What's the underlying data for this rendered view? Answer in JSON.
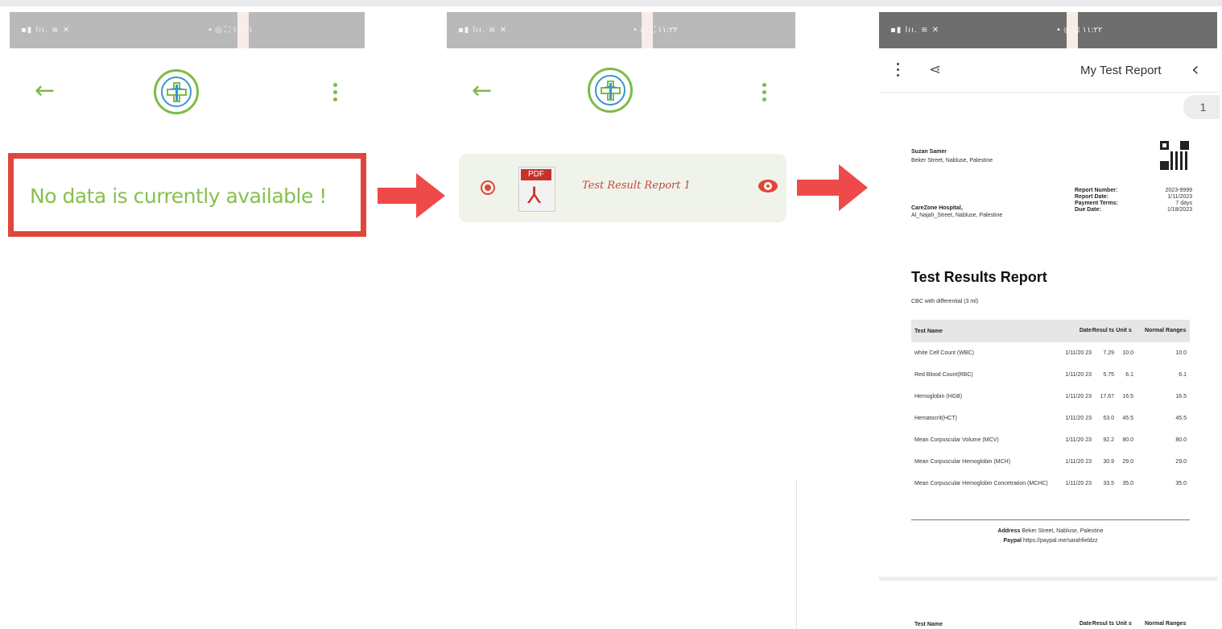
{
  "screens": [
    {
      "status_left": "▪▮ lıı. ≋ ✕",
      "status_right": "• ◎   ⛶ ١١:٢١"
    },
    {
      "status_left": "▪▮ lıı. ≋ ✕",
      "status_right": "• ◎ ⛶ ١١:٢٢"
    },
    {
      "status_left": "▪▮ lıı. ≋ ✕",
      "status_right": "• ◎ ⊡ ١١:٢٢"
    }
  ],
  "empty_state": {
    "message": "No data is currently available !"
  },
  "file_list": {
    "pdf_tag": "PDF",
    "file_name": "Test Result Report 1"
  },
  "viewer": {
    "title": "My Test Report",
    "page_number": "1"
  },
  "report": {
    "patient_name": "Suzan Samer",
    "patient_address": "Beker Street, Nabluse, Palestine",
    "hospital_name": "CareZone Hospital,",
    "hospital_address": "Al_Najah_Street, Nabluse, Palestine",
    "meta": [
      {
        "label": "Report Number:",
        "value": "2023-9999"
      },
      {
        "label": "Report Date:",
        "value": "1/11/2023"
      },
      {
        "label": "Payment Terms:",
        "value": "7 days"
      },
      {
        "label": "Due Date:",
        "value": "1/18/2023"
      }
    ],
    "title": "Test Results Report",
    "subtitle": "CBC with differential (3 ml)",
    "columns": {
      "name": "Test Name",
      "date": "Date",
      "results": "Resul ts",
      "units": "Unit s",
      "normal": "Normal Ranges"
    },
    "rows": [
      {
        "name": "white Cell Count (WBC)",
        "date": "1/11/20 23",
        "result": "7.29",
        "unit": "10.0",
        "normal": "10.0"
      },
      {
        "name": "Red Blood Count(RBC)",
        "date": "1/11/20 23",
        "result": "5.75",
        "unit": "6.1",
        "normal": "6.1"
      },
      {
        "name": "Hemoglobin (HGB)",
        "date": "1/11/20 23",
        "result": "17.67",
        "unit": "16.5",
        "normal": "16.5"
      },
      {
        "name": "Hematocrit(HCT)",
        "date": "1/11/20 23",
        "result": "53.0",
        "unit": "45.5",
        "normal": "45.5"
      },
      {
        "name": "Mean Corpuscular Volume (MCV)",
        "date": "1/11/20 23",
        "result": "92.2",
        "unit": "80.0",
        "normal": "80.0"
      },
      {
        "name": "Mean Corpuscular Hemoglobin (MCH)",
        "date": "1/11/20 23",
        "result": "30.9",
        "unit": "29.0",
        "normal": "29.0"
      },
      {
        "name": "Mean Corpuscular Hemoglobin Concetration (MCHC)",
        "date": "1/11/20 23",
        "result": "33.5",
        "unit": "35.0",
        "normal": "35.0"
      }
    ],
    "footer": {
      "address_label": "Address",
      "address_value": "Beker Street, Nabluse, Palestine",
      "paypal_label": "Paypal",
      "paypal_value": "https://paypal.me/sarahfieldzz"
    }
  },
  "next_page_header": {
    "name": "Test Name",
    "date": "Date",
    "results": "Resul ts",
    "units": "Unit s",
    "normal": "Normal Ranges"
  },
  "colors": {
    "brand_green": "#7dbb4a",
    "accent_red": "#e0463b",
    "status_bar": "#b9b9b9"
  },
  "icons": [
    "back-arrow-icon",
    "more-vert-icon",
    "medical-logo-icon",
    "radio-selected-icon",
    "pdf-file-icon",
    "eye-icon",
    "share-icon",
    "chevron-left-icon",
    "qr-code-icon",
    "right-arrow-icon"
  ]
}
